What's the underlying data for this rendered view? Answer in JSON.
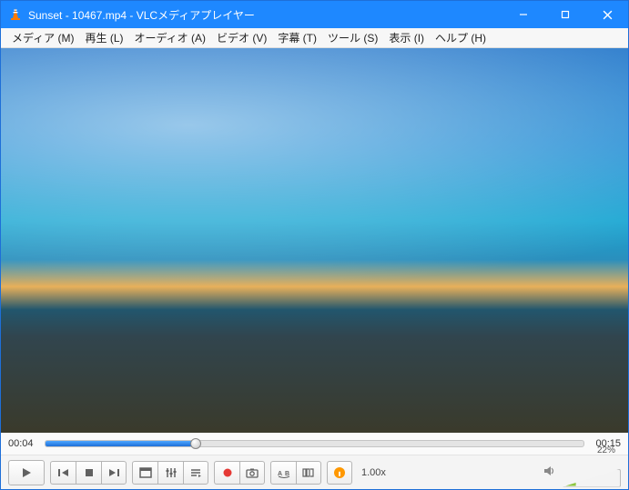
{
  "window": {
    "title": "Sunset - 10467.mp4 - VLCメディアプレイヤー"
  },
  "menu": {
    "media": "メディア (M)",
    "playback": "再生 (L)",
    "audio": "オーディオ (A)",
    "video": "ビデオ (V)",
    "subtitle": "字幕 (T)",
    "tools": "ツール (S)",
    "view": "表示 (I)",
    "help": "ヘルプ (H)"
  },
  "time": {
    "elapsed": "00:04",
    "total": "00:15",
    "progress_percent": 28
  },
  "controls": {
    "speed": "1.00x",
    "volume_percent_label": "22%",
    "volume_percent": 22
  }
}
